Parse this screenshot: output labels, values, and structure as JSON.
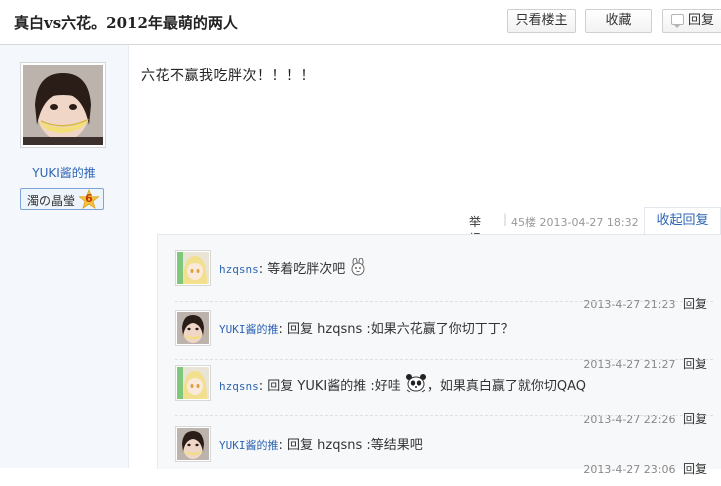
{
  "header": {
    "title": "真白vs六花。2012年最萌的两人",
    "only_op_label": "只看楼主",
    "favorite_label": "收藏",
    "reply_label": "回复",
    "reply_icon": "speech-bubble-icon"
  },
  "author": {
    "name": "YUKI酱的推",
    "level_name": "濁の晶瑩",
    "level_number": "6"
  },
  "post": {
    "content": "六花不赢我吃胖次！！！！",
    "report_label": "举报",
    "separator": "|",
    "floor_time": "45楼  2013-04-27 18:32",
    "collapse_label": "收起回复"
  },
  "comments": [
    {
      "user": "hzqsns",
      "text": "等着吃胖次吧",
      "time": "2013-4-27 21:23",
      "reply_label": "回复",
      "emoji": "bunny-face-emoji"
    },
    {
      "user": "YUKI酱的推",
      "text": "回复 hzqsns :如果六花赢了你切丁丁？",
      "time": "2013-4-27 21:27",
      "reply_label": "回复"
    },
    {
      "user": "hzqsns",
      "text_before": "回复 YUKI酱的推 :好哇",
      "text_after": "，如果真白赢了就你切QAQ",
      "time": "2013-4-27 22:26",
      "reply_label": "回复",
      "emoji": "panda-face-emoji"
    },
    {
      "user": "YUKI酱的推",
      "text": "回复 hzqsns :等结果吧",
      "time": "2013-4-27 23:06",
      "reply_label": "回复"
    }
  ],
  "colors": {
    "link_blue": "#2d64b3",
    "sidebar_bg": "#f4f8fc",
    "comment_bg": "#f7f8fa"
  }
}
